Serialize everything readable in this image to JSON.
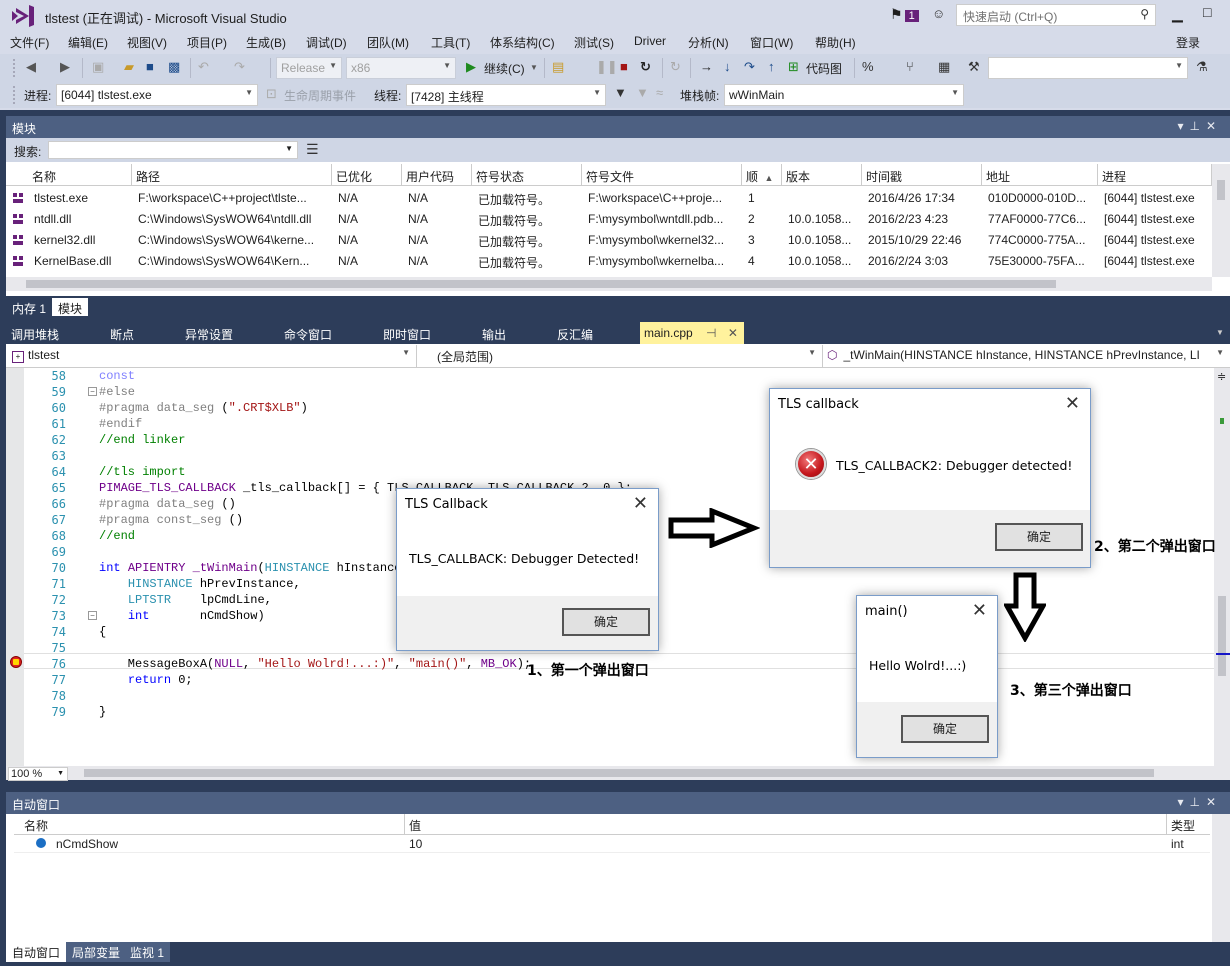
{
  "window": {
    "title": "tlstest (正在调试) - Microsoft Visual Studio",
    "notification_count": "1",
    "quick_launch_placeholder": "快速启动 (Ctrl+Q)",
    "login": "登录"
  },
  "menu": [
    "文件(F)",
    "编辑(E)",
    "视图(V)",
    "项目(P)",
    "生成(B)",
    "调试(D)",
    "团队(M)",
    "工具(T)",
    "体系结构(C)",
    "测试(S)",
    "Driver",
    "分析(N)",
    "窗口(W)",
    "帮助(H)"
  ],
  "toolbar": {
    "config": "Release",
    "platform": "x86",
    "continue_label": "继续(C)",
    "codemap_label": "代码图",
    "process_label": "进程:",
    "process_value": "[6044] tlstest.exe",
    "lifecycle_label": "生命周期事件",
    "thread_label": "线程:",
    "thread_value": "[7428] 主线程",
    "stackframe_label": "堆栈帧:",
    "stackframe_value": "wWinMain"
  },
  "modules": {
    "title": "模块",
    "search_label": "搜索:",
    "columns": [
      "名称",
      "路径",
      "已优化",
      "用户代码",
      "符号状态",
      "符号文件",
      "顺",
      "版本",
      "时间戳",
      "地址",
      "进程"
    ],
    "rows": [
      {
        "name": "tlstest.exe",
        "path": "F:\\workspace\\C++project\\tlste...",
        "opt": "N/A",
        "user": "N/A",
        "sym": "已加载符号。",
        "symfile": "F:\\workspace\\C++proje...",
        "order": "1",
        "version": "",
        "timestamp": "2016/4/26 17:34",
        "address": "010D0000-010D...",
        "process": "[6044] tlstest.exe"
      },
      {
        "name": "ntdll.dll",
        "path": "C:\\Windows\\SysWOW64\\ntdll.dll",
        "opt": "N/A",
        "user": "N/A",
        "sym": "已加载符号。",
        "symfile": "F:\\mysymbol\\wntdll.pdb...",
        "order": "2",
        "version": "10.0.1058...",
        "timestamp": "2016/2/23 4:23",
        "address": "77AF0000-77C6...",
        "process": "[6044] tlstest.exe"
      },
      {
        "name": "kernel32.dll",
        "path": "C:\\Windows\\SysWOW64\\kerne...",
        "opt": "N/A",
        "user": "N/A",
        "sym": "已加载符号。",
        "symfile": "F:\\mysymbol\\wkernel32...",
        "order": "3",
        "version": "10.0.1058...",
        "timestamp": "2015/10/29 22:46",
        "address": "774C0000-775A...",
        "process": "[6044] tlstest.exe"
      },
      {
        "name": "KernelBase.dll",
        "path": "C:\\Windows\\SysWOW64\\Kern...",
        "opt": "N/A",
        "user": "N/A",
        "sym": "已加载符号。",
        "symfile": "F:\\mysymbol\\wkernelba...",
        "order": "4",
        "version": "10.0.1058...",
        "timestamp": "2016/2/24 3:03",
        "address": "75E30000-75FA...",
        "process": "[6044] tlstest.exe"
      }
    ],
    "bottom_tabs": [
      "内存 1",
      "模块"
    ]
  },
  "doc_tabs": [
    "调用堆栈",
    "断点",
    "异常设置",
    "命令窗口",
    "即时窗口",
    "输出",
    "反汇编"
  ],
  "active_doc": "main.cpp",
  "navbar": {
    "project": "tlstest",
    "scope": "(全局范围)",
    "member": "_tWinMain(HINSTANCE hInstance, HINSTANCE hPrevInstance, LI"
  },
  "editor": {
    "zoom": "100 %",
    "lines": [
      {
        "n": "58",
        "t": [
          [
            "cn",
            "const"
          ]
        ]
      },
      {
        "n": "59",
        "t": [
          [
            "pp",
            "#else"
          ]
        ]
      },
      {
        "n": "60",
        "t": [
          [
            "pp",
            "#pragma data_seg "
          ],
          [
            "",
            "("
          ],
          [
            "st",
            "\".CRT$XLB\""
          ],
          [
            "",
            ")"
          ]
        ]
      },
      {
        "n": "61",
        "t": [
          [
            "pp",
            "#endif"
          ]
        ]
      },
      {
        "n": "62",
        "t": [
          [
            "cm",
            "//end linker"
          ]
        ]
      },
      {
        "n": "63",
        "t": []
      },
      {
        "n": "64",
        "t": [
          [
            "cm",
            "//tls import"
          ]
        ]
      },
      {
        "n": "65",
        "t": [
          [
            "mc",
            "PIMAGE_TLS_CALLBACK"
          ],
          [
            "",
            " _tls_callback[] = { TLS_CALLBACK, TLS_CALLBACK_2, 0 };"
          ]
        ]
      },
      {
        "n": "66",
        "t": [
          [
            "pp",
            "#pragma data_seg "
          ],
          [
            "",
            "()"
          ]
        ]
      },
      {
        "n": "67",
        "t": [
          [
            "pp",
            "#pragma const_seg "
          ],
          [
            "",
            "()"
          ]
        ]
      },
      {
        "n": "68",
        "t": [
          [
            "cm",
            "//end"
          ]
        ]
      },
      {
        "n": "69",
        "t": []
      },
      {
        "n": "70",
        "t": [
          [
            "kw",
            "int"
          ],
          [
            "",
            " "
          ],
          [
            "mc",
            "APIENTRY"
          ],
          [
            "",
            " "
          ],
          [
            "mc",
            "_tWinMain"
          ],
          [
            "",
            "("
          ],
          [
            "ty",
            "HINSTANCE"
          ],
          [
            "",
            " hInstance,"
          ]
        ]
      },
      {
        "n": "71",
        "t": [
          [
            "",
            "    "
          ],
          [
            "ty",
            "HINSTANCE"
          ],
          [
            "",
            " hPrevInstance,"
          ]
        ]
      },
      {
        "n": "72",
        "t": [
          [
            "",
            "    "
          ],
          [
            "ty",
            "LPTSTR"
          ],
          [
            "",
            "    lpCmdLine,"
          ]
        ]
      },
      {
        "n": "73",
        "t": [
          [
            "",
            "    "
          ],
          [
            "kw",
            "int"
          ],
          [
            "",
            "       nCmdShow)"
          ]
        ]
      },
      {
        "n": "74",
        "t": [
          [
            "",
            "{"
          ]
        ]
      },
      {
        "n": "75",
        "t": []
      },
      {
        "n": "76",
        "t": [
          [
            "",
            "    MessageBoxA("
          ],
          [
            "mc",
            "NULL"
          ],
          [
            "",
            ", "
          ],
          [
            "st",
            "\"Hello Wolrd!...:)\""
          ],
          [
            "",
            ", "
          ],
          [
            "st",
            "\"main()\""
          ],
          [
            "",
            ", "
          ],
          [
            "mc",
            "MB_OK"
          ],
          [
            "",
            ");"
          ]
        ]
      },
      {
        "n": "77",
        "t": [
          [
            "",
            "    "
          ],
          [
            "kw",
            "return"
          ],
          [
            "",
            " 0;"
          ]
        ]
      },
      {
        "n": "78",
        "t": []
      },
      {
        "n": "79",
        "t": [
          [
            "",
            "}"
          ]
        ]
      }
    ]
  },
  "dialogs": {
    "first": {
      "title": "TLS Callback",
      "message": "TLS_CALLBACK: Debugger Detected!",
      "ok": "确定"
    },
    "second": {
      "title": "TLS callback",
      "message": "TLS_CALLBACK2: Debugger detected!",
      "ok": "确定",
      "icon": "error-icon"
    },
    "third": {
      "title": "main()",
      "message": "Hello Wolrd!...:)",
      "ok": "确定"
    }
  },
  "annotations": {
    "first": "1、第一个弹出窗口",
    "second": "2、第二个弹出窗口",
    "third": "3、第三个弹出窗口"
  },
  "autos": {
    "title": "自动窗口",
    "columns": [
      "名称",
      "值",
      "类型"
    ],
    "rows": [
      {
        "name": "nCmdShow",
        "value": "10",
        "type": "int"
      }
    ],
    "bottom_tabs": [
      "自动窗口",
      "局部变量",
      "监视 1"
    ]
  }
}
